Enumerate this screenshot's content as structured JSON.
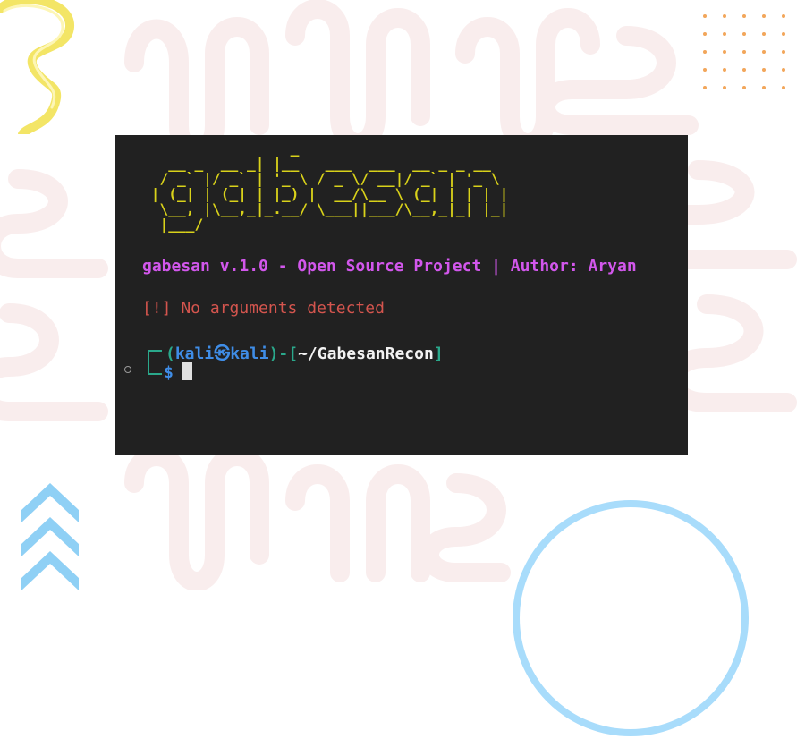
{
  "terminal": {
    "ascii_logo": "                 _\n   __ _  __ _| |__   ___  ___  __ _ _ __\n  / _` |/ _` | '_ \\ / _ \\/ __|/ _` | '_ \\\n | (_| | (_| | |_) |  __/\\__ \\ (_| | | | |\n  \\__, |\\__,_|_.__/ \\___||___/\\__,_|_| |_|\n  |___/",
    "banner": "gabesan v.1.0 - Open Source Project | Author: Aryan",
    "warning": "[!] No arguments detected",
    "prompt": {
      "open": "(",
      "user": "kali",
      "at_symbol": "㉿",
      "host": "kali",
      "close": ")",
      "sep": "-[",
      "path": "~/GabesanRecon",
      "path_close": "]",
      "symbol": "$"
    }
  },
  "decor": {
    "background_pattern": "squiggles-icon",
    "top_left": "yellow-ribbon-icon",
    "top_right": "orange-dot-grid-icon",
    "bottom_left": "blue-chevron-up-icon",
    "bottom_right": "blue-ring-icon"
  },
  "colors": {
    "logo": "#d9d21a",
    "banner": "#d257ec",
    "warning": "#d4554e",
    "prompt_bracket": "#2aa88b",
    "prompt_user": "#3f8de7",
    "terminal_bg": "#212121"
  }
}
